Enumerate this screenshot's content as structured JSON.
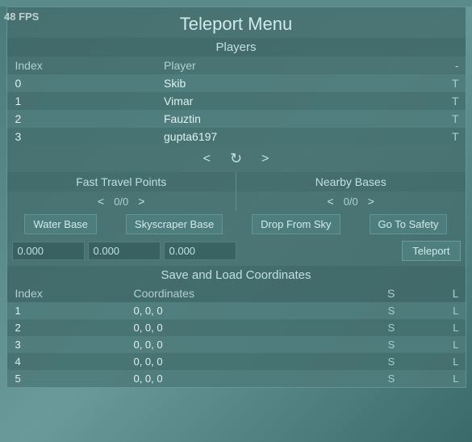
{
  "fps": "48 FPS",
  "title": "Teleport Menu",
  "players_section": {
    "header": "Players",
    "columns": [
      "Index",
      "Player",
      "-"
    ],
    "rows": [
      {
        "index": "0",
        "name": "Skib",
        "action": "T"
      },
      {
        "index": "1",
        "name": "Vimar",
        "action": "T"
      },
      {
        "index": "2",
        "name": "Fauztin",
        "action": "T"
      },
      {
        "index": "3",
        "name": "gupta6197",
        "action": "T"
      }
    ]
  },
  "nav": {
    "left": "<",
    "refresh": "↻",
    "right": ">"
  },
  "fast_travel": {
    "header": "Fast Travel Points",
    "nav_left": "<",
    "nav_right": ">",
    "counter": "0/0",
    "points": [
      "Water Base",
      "Skyscraper Base",
      "Drop From Sky",
      "Go To Safety"
    ]
  },
  "nearby_bases": {
    "header": "Nearby Bases",
    "nav_left": "<",
    "nav_right": ">",
    "counter": "0/0"
  },
  "coords": {
    "x_placeholder": "0.000",
    "y_placeholder": "0.000",
    "z_placeholder": "0.000",
    "teleport_btn": "Teleport"
  },
  "save_load": {
    "header": "Save and Load Coordinates",
    "columns": [
      "Index",
      "Coordinates",
      "S",
      "L"
    ],
    "rows": [
      {
        "index": "1",
        "coords": "0, 0, 0"
      },
      {
        "index": "2",
        "coords": "0, 0, 0"
      },
      {
        "index": "3",
        "coords": "0, 0, 0"
      },
      {
        "index": "4",
        "coords": "0, 0, 0"
      },
      {
        "index": "5",
        "coords": "0, 0, 0"
      }
    ],
    "s_label": "S",
    "l_label": "L"
  }
}
